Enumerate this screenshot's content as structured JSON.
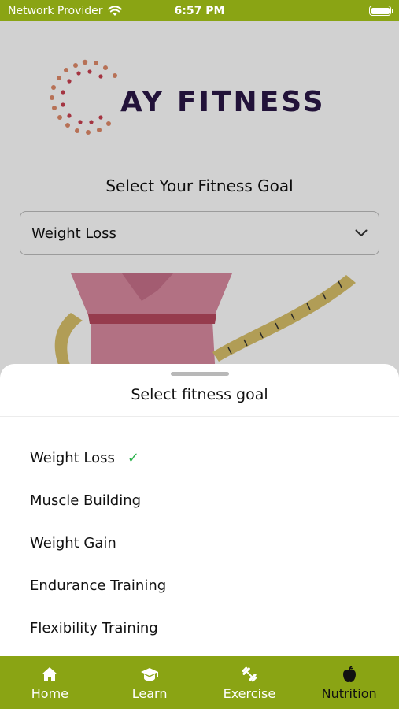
{
  "status_bar": {
    "carrier": "Network Provider",
    "time": "6:57 PM"
  },
  "app": {
    "logo_text": "AY FITNESS",
    "goal_prompt": "Select Your Fitness Goal",
    "selected_goal": "Weight Loss"
  },
  "sheet": {
    "title": "Select fitness goal",
    "options": [
      {
        "label": "Weight Loss",
        "selected": true
      },
      {
        "label": "Muscle Building",
        "selected": false
      },
      {
        "label": "Weight Gain",
        "selected": false
      },
      {
        "label": "Endurance Training",
        "selected": false
      },
      {
        "label": "Flexibility Training",
        "selected": false
      }
    ],
    "check_mark": "✓"
  },
  "tab_bar": {
    "tabs": [
      {
        "label": "Home",
        "icon": "home-icon",
        "active": false
      },
      {
        "label": "Learn",
        "icon": "graduation-cap-icon",
        "active": false
      },
      {
        "label": "Exercise",
        "icon": "dumbbell-icon",
        "active": false
      },
      {
        "label": "Nutrition",
        "icon": "apple-icon",
        "active": true
      }
    ]
  },
  "colors": {
    "brand_green": "#8aa414",
    "logo_text": "#2a1746",
    "check_green": "#2bb24c"
  }
}
